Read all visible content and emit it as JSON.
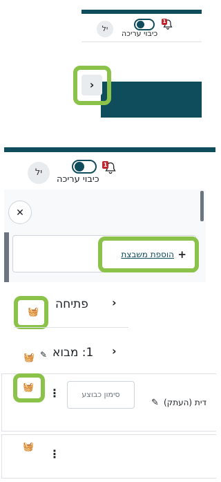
{
  "header_top": {
    "edit_mode_label": "כיבוי עריכה",
    "notification_count": "1",
    "avatar_initials": "יל",
    "accent_color": "#0f4c5c"
  },
  "drawer_toggle": {
    "icon": "chevron-right-icon"
  },
  "header_bottom": {
    "edit_mode_label": "כיבוי עריכה",
    "notification_count": "1",
    "avatar_initials": "יל"
  },
  "drawer": {
    "close_icon": "close-icon",
    "add_block_label": "הוספת משבצת",
    "add_icon": "plus-icon"
  },
  "course_index": {
    "sections": [
      {
        "title": "פתיחה"
      },
      {
        "title": "1: מבוא"
      }
    ]
  },
  "activities": {
    "completion_button_label": "סימון כבוצע",
    "activity_title": "דית (העתק)",
    "icons": {
      "basket": "basket-icon",
      "kebab": "kebab-menu-icon",
      "edit": "pencil-icon"
    }
  },
  "highlight_color": "#8bc34a"
}
